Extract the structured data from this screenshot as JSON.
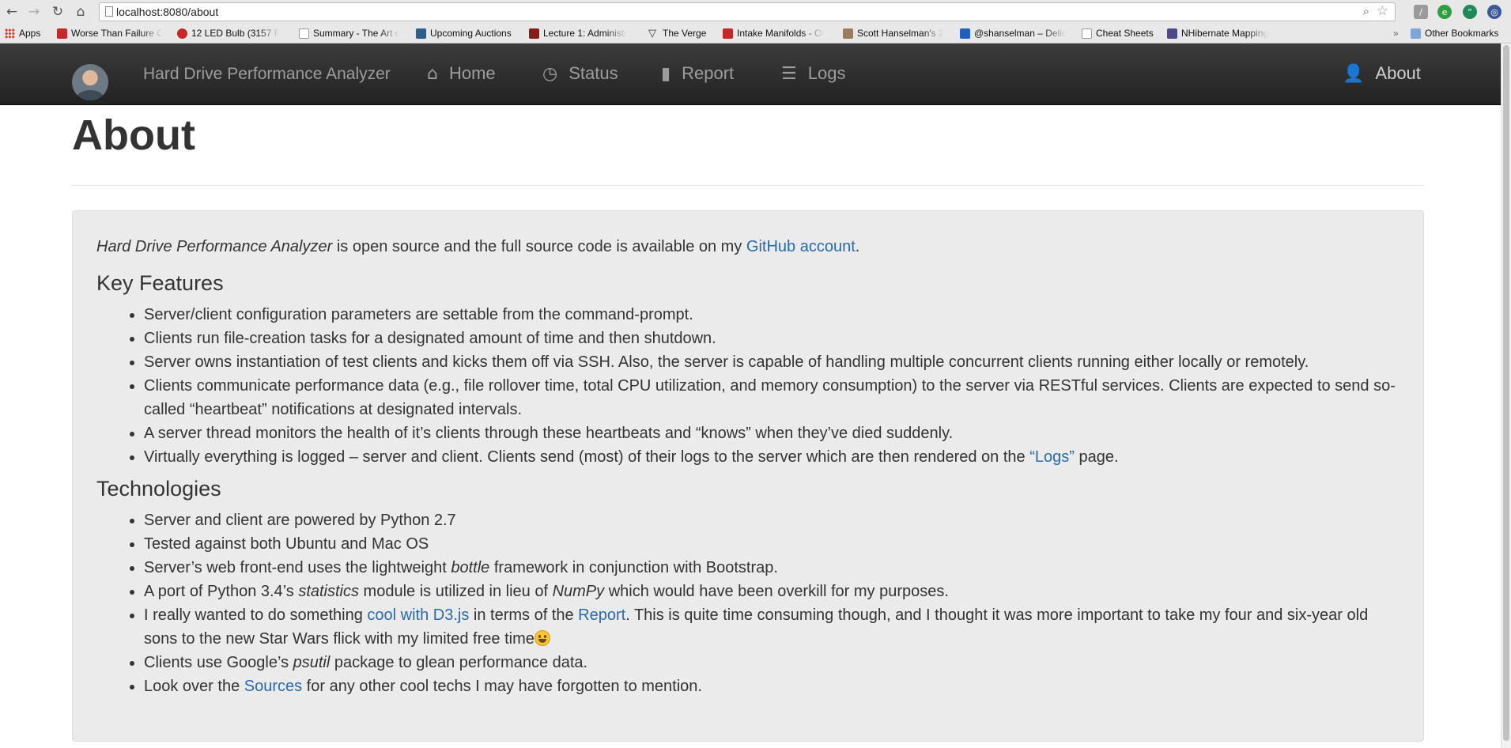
{
  "browser": {
    "url": "localhost:8080/about",
    "bookmarks": [
      {
        "label": "Apps",
        "color": "#d23f31"
      },
      {
        "label": "Worse Than Failure C",
        "color": "#c62828"
      },
      {
        "label": "12 LED Bulb (3157 F",
        "color": "#c62828"
      },
      {
        "label": "Summary - The Art o",
        "color": "#ffffff"
      },
      {
        "label": "Upcoming Auctions",
        "color": "#2e5e8c"
      },
      {
        "label": "Lecture 1: Administr",
        "color": "#8b1a1a"
      },
      {
        "label": "The Verge",
        "color": "#333333"
      },
      {
        "label": "Intake Manifolds - Ol",
        "color": "#c62828"
      },
      {
        "label": "Scott Hanselman's 2",
        "color": "#9b7b5b"
      },
      {
        "label": "@shanselman – Delic",
        "color": "#1f5fbf"
      },
      {
        "label": "Cheat Sheets",
        "color": "#ffffff"
      },
      {
        "label": "NHibernate Mapping",
        "color": "#4a4a8a"
      }
    ],
    "overflow": "»",
    "other_bookmarks": "Other Bookmarks"
  },
  "navbar": {
    "brand": "Hard Drive Performance Analyzer",
    "items": [
      {
        "label": "Home",
        "icon": "home-icon"
      },
      {
        "label": "Status",
        "icon": "dashboard-icon"
      },
      {
        "label": "Report",
        "icon": "stats-icon"
      },
      {
        "label": "Logs",
        "icon": "list-icon"
      }
    ],
    "about": {
      "label": "About",
      "icon": "user-icon"
    }
  },
  "page": {
    "title": "About",
    "intro": {
      "app_name": "Hard Drive Performance Analyzer",
      "text": " is open source and the full source code is available on my ",
      "link": "GitHub account",
      "end": "."
    },
    "features_heading": "Key Features",
    "features": [
      "Server/client configuration parameters are settable from the command-prompt.",
      "Clients run file-creation tasks for a designated amount of time and then shutdown.",
      "Server owns instantiation of test clients and kicks them off via SSH. Also, the server is capable of handling multiple concurrent clients running either locally or remotely.",
      "Clients communicate performance data (e.g., file rollover time, total CPU utilization, and memory consumption) to the server via RESTful services. Clients are expected to send so-called “heartbeat” notifications at designated intervals.",
      "A server thread monitors the health of it’s clients through these heartbeats and “knows” when they’ve died suddenly."
    ],
    "feature_logs": {
      "before": "Virtually everything is logged – server and client. Clients send (most) of their logs to the server which are then rendered on the ",
      "link": "“Logs”",
      "after": " page."
    },
    "tech_heading": "Technologies",
    "tech": {
      "python": "Server and client are powered by Python 2.7",
      "tested": "Tested against both Ubuntu and Mac OS",
      "bottle_before": "Server’s web front-end uses the lightweight ",
      "bottle_em": "bottle",
      "bottle_after": " framework in conjunction with Bootstrap.",
      "stats_before": "A port of Python 3.4’s ",
      "stats_em": "statistics",
      "stats_mid": " module is utilized in lieu of ",
      "stats_em2": "NumPy",
      "stats_after": " which would have been overkill for my purposes.",
      "d3_before": "I really wanted to do something ",
      "d3_link": "cool with D3.js",
      "d3_mid": " in terms of the ",
      "d3_link2": "Report",
      "d3_after": ". This is quite time consuming though, and I thought it was more important to take my four and six-year old sons to the new Star Wars flick with my limited free time",
      "psutil_before": "Clients use Google’s ",
      "psutil_em": "psutil",
      "psutil_after": " package to glean performance data.",
      "sources_before": "Look over the ",
      "sources_link": "Sources",
      "sources_after": " for any other cool techs I may have forgotten to mention."
    }
  },
  "colors": {
    "link": "#2a6aaa",
    "navbar": "#222222",
    "well": "#ebebeb"
  }
}
